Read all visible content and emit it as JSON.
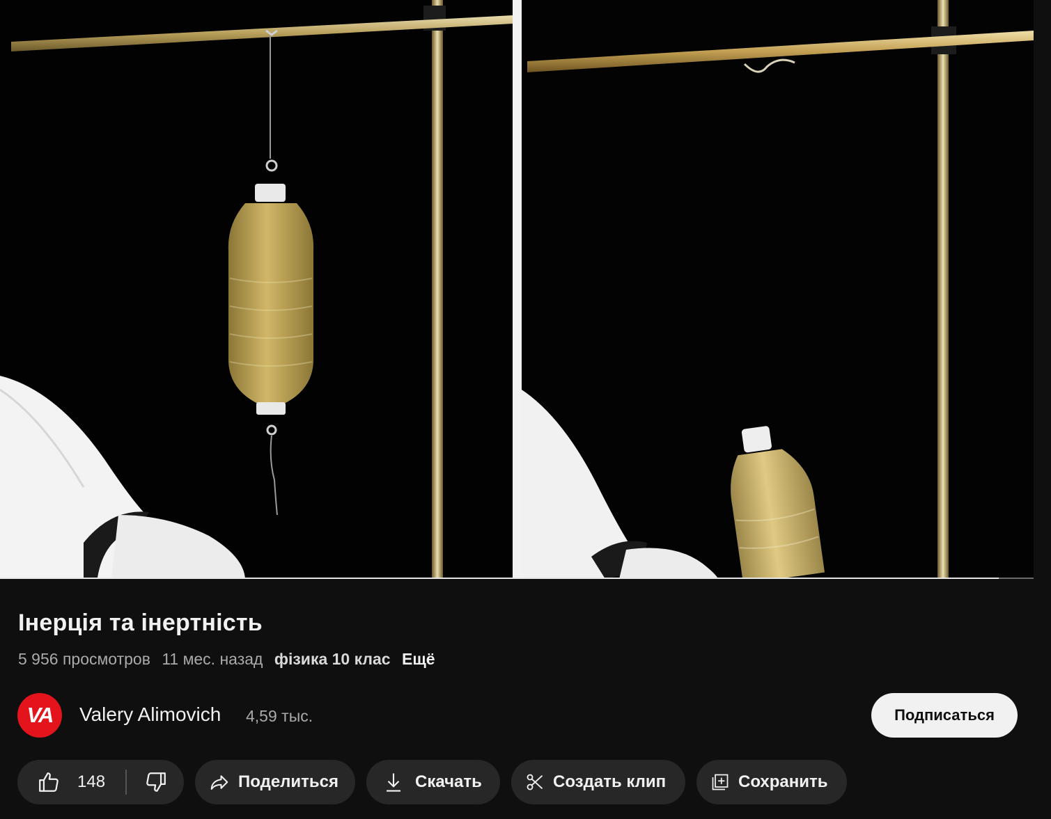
{
  "video": {
    "progress_percent": 96.6
  },
  "info": {
    "title": "Інерція та інертність",
    "views": "5 956 просмотров",
    "date": "11 мес. назад",
    "tag": "фізика 10 клас",
    "more": "Ещё"
  },
  "channel": {
    "avatar_text": "VA",
    "avatar_color": "#e3141b",
    "name": "Valery Alimovich",
    "subscribers": "4,59 тыс.",
    "subscribe_label": "Подписаться"
  },
  "actions": {
    "like_count": "148",
    "share_label": "Поделиться",
    "download_label": "Скачать",
    "clip_label": "Создать клип",
    "save_label": "Сохранить"
  },
  "icons": [
    "thumbs-up-icon",
    "thumbs-down-icon",
    "share-icon",
    "download-icon",
    "scissors-icon",
    "save-playlist-icon"
  ]
}
